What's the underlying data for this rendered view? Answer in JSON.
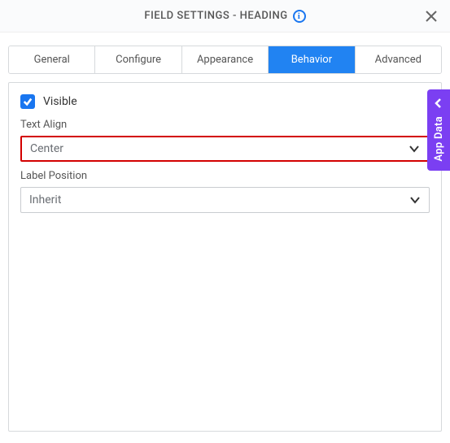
{
  "header": {
    "title": "FIELD SETTINGS - HEADING"
  },
  "tabs": [
    {
      "label": "General"
    },
    {
      "label": "Configure"
    },
    {
      "label": "Appearance"
    },
    {
      "label": "Behavior"
    },
    {
      "label": "Advanced"
    }
  ],
  "behavior": {
    "visible_label": "Visible",
    "text_align_label": "Text Align",
    "text_align_value": "Center",
    "label_position_label": "Label Position",
    "label_position_value": "Inherit"
  },
  "side": {
    "label": "App Data"
  }
}
